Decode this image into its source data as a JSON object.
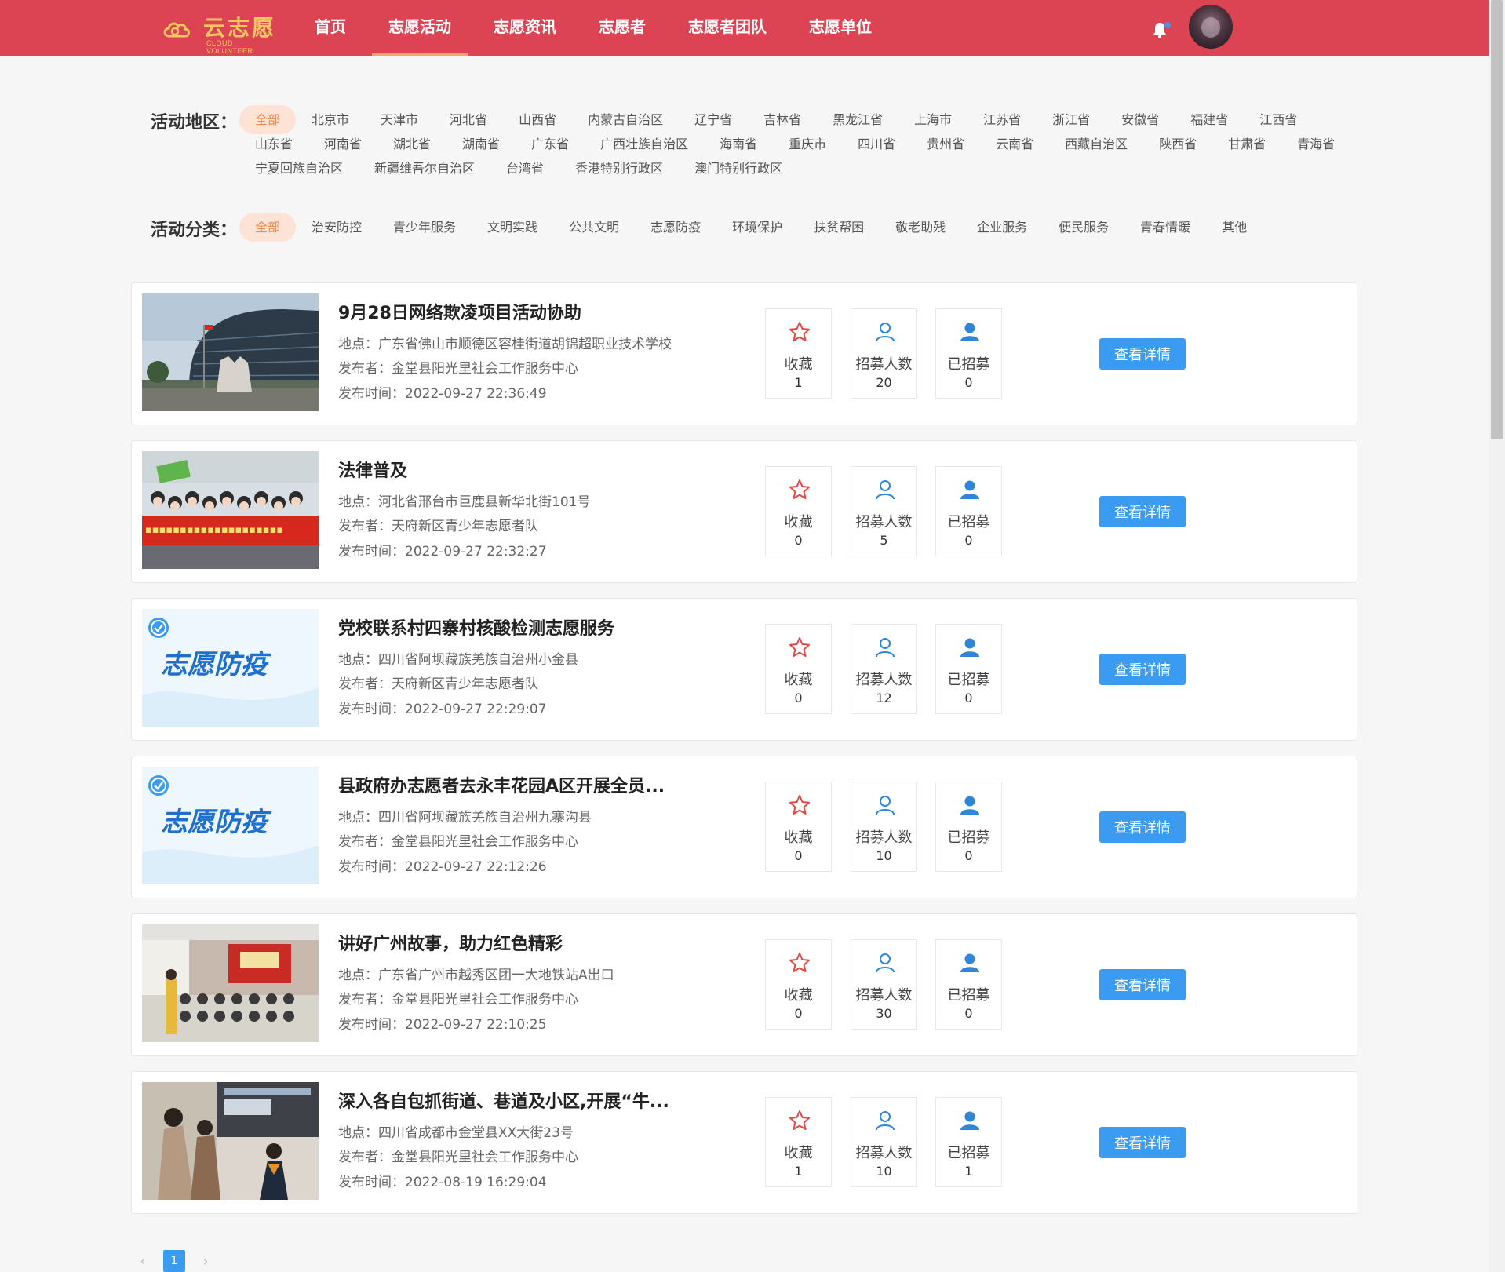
{
  "header": {
    "logo_text": "云志愿",
    "logo_sub": "CLOUD VOLUNTEER",
    "nav": [
      {
        "label": "首页",
        "active": false
      },
      {
        "label": "志愿活动",
        "active": true
      },
      {
        "label": "志愿资讯",
        "active": false
      },
      {
        "label": "志愿者",
        "active": false
      },
      {
        "label": "志愿者团队",
        "active": false
      },
      {
        "label": "志愿单位",
        "active": false
      }
    ],
    "accent": "#dc4453"
  },
  "region_filter": {
    "label": "活动地区：",
    "options": [
      "全部",
      "北京市",
      "天津市",
      "河北省",
      "山西省",
      "内蒙古自治区",
      "辽宁省",
      "吉林省",
      "黑龙江省",
      "上海市",
      "江苏省",
      "浙江省",
      "安徽省",
      "福建省",
      "江西省",
      "山东省",
      "河南省",
      "湖北省",
      "湖南省",
      "广东省",
      "广西壮族自治区",
      "海南省",
      "重庆市",
      "四川省",
      "贵州省",
      "云南省",
      "西藏自治区",
      "陕西省",
      "甘肃省",
      "青海省",
      "宁夏回族自治区",
      "新疆维吾尔自治区",
      "台湾省",
      "香港特别行政区",
      "澳门特别行政区"
    ],
    "selected": "全部"
  },
  "category_filter": {
    "label": "活动分类：",
    "options": [
      "全部",
      "治安防控",
      "青少年服务",
      "文明实践",
      "公共文明",
      "志愿防疫",
      "环境保护",
      "扶贫帮困",
      "敬老助残",
      "企业服务",
      "便民服务",
      "青春情暖",
      "其他"
    ],
    "selected": "全部"
  },
  "labels": {
    "favorite": "收藏",
    "recruit_total": "招募人数",
    "recruited": "已招募",
    "detail_button": "查看详情",
    "epidemic_image_text": "志愿防疫"
  },
  "activities": [
    {
      "title": "9月28日网络欺凌项目活动协助",
      "location": "地点：广东省佛山市顺德区容桂街道胡锦超职业技术学校",
      "publisher": "发布者：金堂县阳光里社会工作服务中心",
      "time": "发布时间：2022-09-27 22:36:49",
      "favorites": "1",
      "recruit": "20",
      "recruited": "0",
      "image": "building"
    },
    {
      "title": "法律普及",
      "location": "地点：河北省邢台市巨鹿县新华北街101号",
      "publisher": "发布者：天府新区青少年志愿者队",
      "time": "发布时间：2022-09-27 22:32:27",
      "favorites": "0",
      "recruit": "5",
      "recruited": "0",
      "image": "group"
    },
    {
      "title": "党校联系村四寨村核酸检测志愿服务",
      "location": "地点：四川省阿坝藏族羌族自治州小金县",
      "publisher": "发布者：天府新区青少年志愿者队",
      "time": "发布时间：2022-09-27 22:29:07",
      "favorites": "0",
      "recruit": "12",
      "recruited": "0",
      "image": "epidemic"
    },
    {
      "title": "县政府办志愿者去永丰花园A区开展全员...",
      "location": "地点：四川省阿坝藏族羌族自治州九寨沟县",
      "publisher": "发布者：金堂县阳光里社会工作服务中心",
      "time": "发布时间：2022-09-27 22:12:26",
      "favorites": "0",
      "recruit": "10",
      "recruited": "0",
      "image": "epidemic"
    },
    {
      "title": "讲好广州故事，助力红色精彩",
      "location": "地点：广东省广州市越秀区团一大地铁站A出口",
      "publisher": "发布者：金堂县阳光里社会工作服务中心",
      "time": "发布时间：2022-09-27 22:10:25",
      "favorites": "0",
      "recruit": "30",
      "recruited": "0",
      "image": "classroom"
    },
    {
      "title": "深入各自包抓街道、巷道及小区,开展“牛...",
      "location": "地点：四川省成都市金堂县XX大街23号",
      "publisher": "发布者：金堂县阳光里社会工作服务中心",
      "time": "发布时间：2022-08-19 16:29:04",
      "favorites": "1",
      "recruit": "10",
      "recruited": "1",
      "image": "exhibit"
    }
  ],
  "pagination": {
    "prev": "‹",
    "current": "1",
    "next": "›"
  }
}
